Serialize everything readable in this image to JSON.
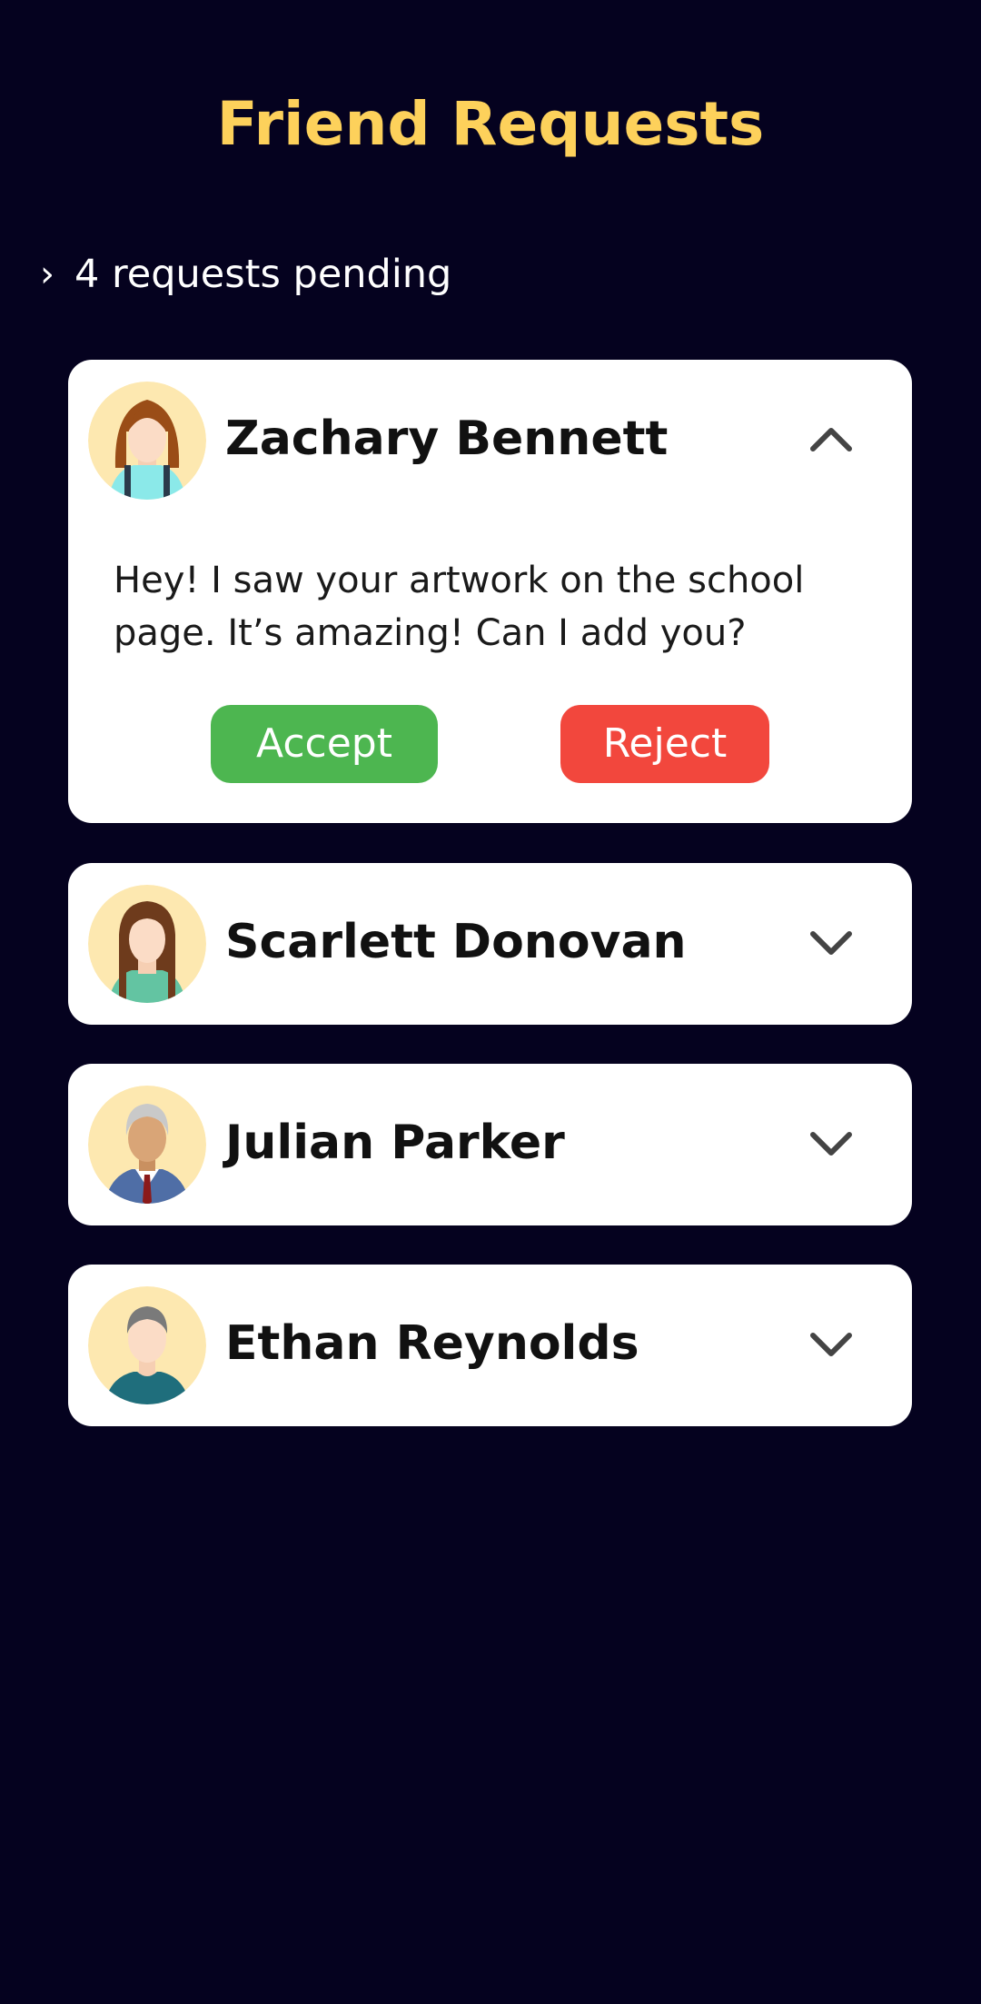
{
  "header": {
    "title": "Friend Requests"
  },
  "pending": {
    "label": "4 requests pending"
  },
  "requests": [
    {
      "name": "Zachary Bennett",
      "expanded": true,
      "message": "Hey! I saw your artwork on the school page. It’s amazing! Can I add you?",
      "accept_label": "Accept",
      "reject_label": "Reject"
    },
    {
      "name": "Scarlett Donovan",
      "expanded": false
    },
    {
      "name": "Julian Parker",
      "expanded": false
    },
    {
      "name": "Ethan Reynolds",
      "expanded": false
    }
  ],
  "icons": {
    "pending_toggle": "chevron-right-icon",
    "expanded_toggle": "chevron-up-icon",
    "collapsed_toggle": "chevron-down-icon"
  },
  "colors": {
    "background": "#05021f",
    "title": "#fdd15b",
    "card": "#ffffff",
    "accept": "#4db650",
    "reject": "#f2473d",
    "avatar_bg": "#fde8b0"
  }
}
